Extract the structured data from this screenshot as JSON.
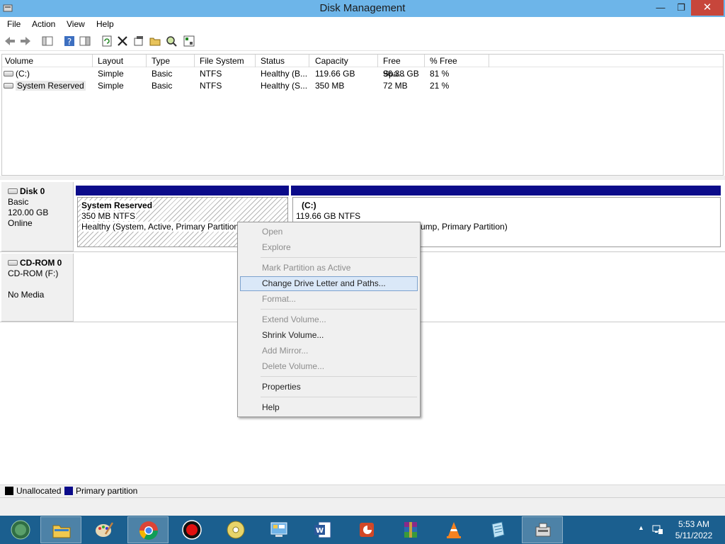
{
  "window": {
    "title": "Disk Management"
  },
  "menubar": {
    "items": [
      "File",
      "Action",
      "View",
      "Help"
    ]
  },
  "volumes": {
    "columns": [
      "Volume",
      "Layout",
      "Type",
      "File System",
      "Status",
      "Capacity",
      "Free Spa...",
      "% Free"
    ],
    "rows": [
      [
        "(C:)",
        "Simple",
        "Basic",
        "NTFS",
        "Healthy (B...",
        "119.66 GB",
        "96.38 GB",
        "81 %"
      ],
      [
        "System Reserved",
        "Simple",
        "Basic",
        "NTFS",
        "Healthy (S...",
        "350 MB",
        "72 MB",
        "21 %"
      ]
    ]
  },
  "disks": [
    {
      "name": "Disk 0",
      "lines": [
        "Basic",
        "120.00 GB",
        "Online"
      ]
    },
    {
      "name": "CD-ROM 0",
      "lines": [
        "CD-ROM (F:)",
        "",
        "No Media"
      ]
    }
  ],
  "partitions": [
    {
      "name": "System Reserved",
      "size": "350 MB NTFS",
      "status": "Healthy (System, Active, Primary Partition"
    },
    {
      "name": "(C:)",
      "size": "119.66 GB NTFS",
      "status": "ump, Primary Partition)"
    }
  ],
  "legend": [
    {
      "label": "Unallocated",
      "color": "#000000"
    },
    {
      "label": "Primary partition",
      "color": "#0b0b8a"
    }
  ],
  "context_menu": {
    "items": [
      {
        "label": "Open",
        "enabled": false
      },
      {
        "label": "Explore",
        "enabled": false
      },
      {
        "label": "Mark Partition as Active",
        "enabled": false
      },
      {
        "label": "Change Drive Letter and Paths...",
        "enabled": true,
        "highlighted": true
      },
      {
        "label": "Format...",
        "enabled": false
      },
      {
        "label": "Extend Volume...",
        "enabled": false
      },
      {
        "label": "Shrink Volume...",
        "enabled": true
      },
      {
        "label": "Add Mirror...",
        "enabled": false
      },
      {
        "label": "Delete Volume...",
        "enabled": false
      },
      {
        "label": "Properties",
        "enabled": true
      },
      {
        "label": "Help",
        "enabled": true
      }
    ]
  },
  "taskbar": {
    "apps": [
      "start-orb",
      "file-explorer",
      "paint",
      "chrome",
      "record",
      "dvd-player",
      "control-panel",
      "word",
      "powerpoint",
      "winrar",
      "vlc",
      "notepad",
      "disk-management"
    ],
    "clock": {
      "time": "5:53 AM",
      "date": "5/11/2022"
    }
  },
  "colors": {
    "titlebar": "#6db5e9",
    "partition_bar": "#0b0b8a",
    "taskbar": "#1b5f8f",
    "menu_highlight": "#dae8f8"
  }
}
